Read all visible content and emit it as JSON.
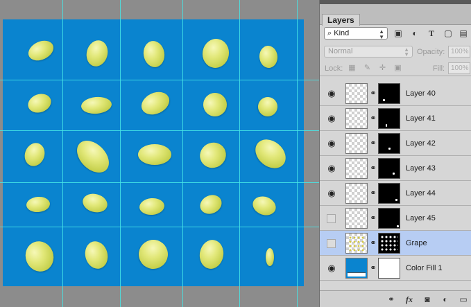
{
  "panel": {
    "tab_label": "Layers",
    "filter": {
      "kind_label": "Kind",
      "icons": [
        "image-filter-icon",
        "adjustment-filter-icon",
        "type-filter-icon",
        "shape-filter-icon",
        "smart-object-filter-icon"
      ]
    },
    "blend_mode": "Normal",
    "opacity_label": "Opacity:",
    "opacity_value": "100%",
    "lock_label": "Lock:",
    "fill_label": "Fill:",
    "fill_value": "100%"
  },
  "layers": [
    {
      "name": "Layer 40",
      "visible": true,
      "selected": false
    },
    {
      "name": "Layer 41",
      "visible": true,
      "selected": false
    },
    {
      "name": "Layer 42",
      "visible": true,
      "selected": false
    },
    {
      "name": "Layer 43",
      "visible": true,
      "selected": false
    },
    {
      "name": "Layer 44",
      "visible": true,
      "selected": false
    },
    {
      "name": "Layer 45",
      "visible": false,
      "selected": false
    },
    {
      "name": "Grape",
      "visible": false,
      "selected": true
    },
    {
      "name": "Color Fill 1",
      "visible": true,
      "selected": false
    }
  ],
  "colors": {
    "canvas_fill": "#0a84cf",
    "guide": "#47e6e6",
    "grape": "#d9e06a",
    "selected_row": "#b7cdf3"
  }
}
